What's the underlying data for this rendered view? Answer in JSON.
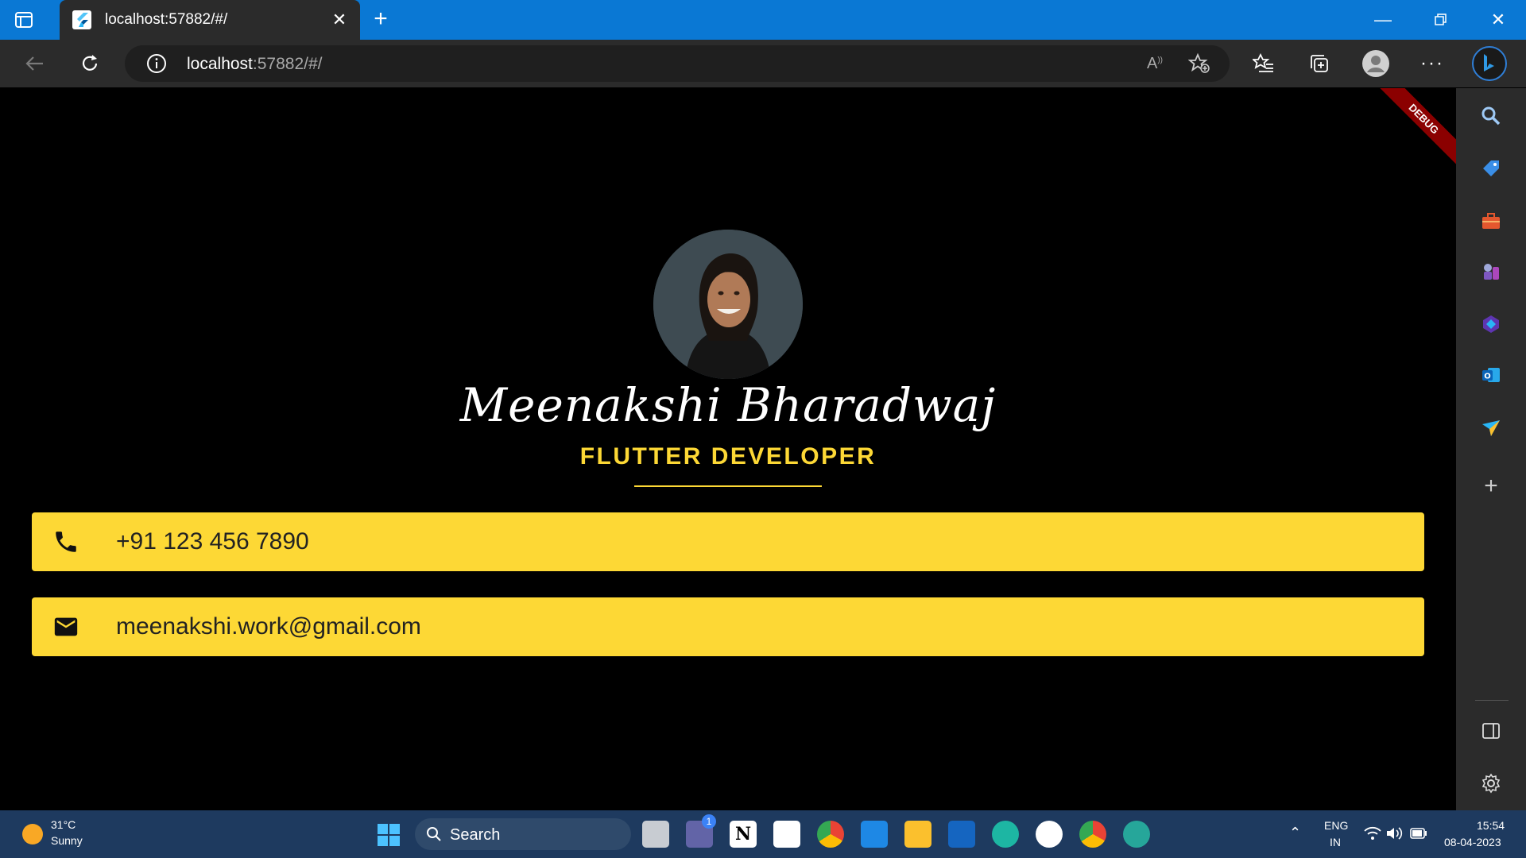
{
  "browser": {
    "tab_title": "localhost:57882/#/",
    "url_host": "localhost",
    "url_rest": ":57882/#/"
  },
  "page": {
    "debug_label": "DEBUG",
    "name": "Meenakshi Bharadwaj",
    "role": "FLUTTER DEVELOPER",
    "phone": "+91 123 456 7890",
    "email": "meenakshi.work@gmail.com",
    "colors": {
      "accent": "#fdd835",
      "background": "#000000",
      "card_text": "#222222"
    }
  },
  "taskbar": {
    "weather_temp": "31°C",
    "weather_condition": "Sunny",
    "search_label": "Search",
    "lang_primary": "ENG",
    "lang_secondary": "IN",
    "time": "15:54",
    "date": "08-04-2023",
    "badge_count": "1"
  }
}
